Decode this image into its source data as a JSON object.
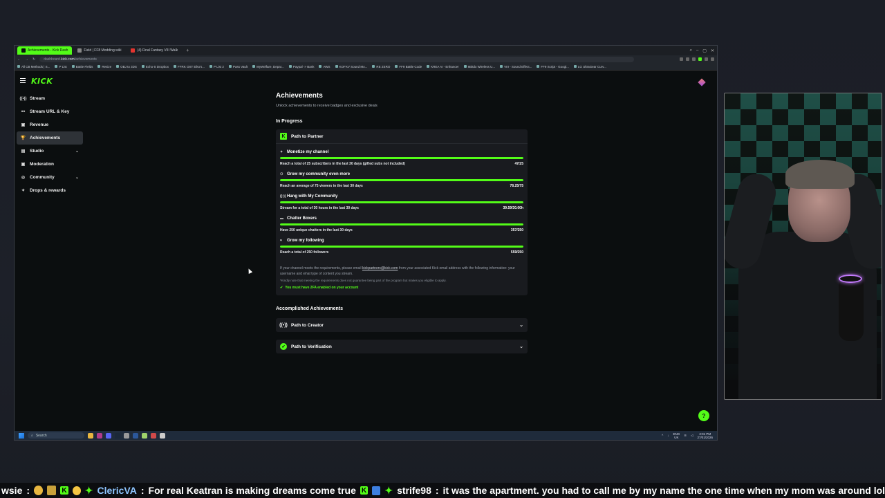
{
  "browser": {
    "tabs": [
      {
        "label": "Achievements - Kick Dash",
        "active": true
      },
      {
        "label": "Field | FF8 Modding wiki",
        "active": false
      },
      {
        "label": "(4) Final Fantasy VIII Walk",
        "active": false
      }
    ],
    "address_prefix": "dashboard.",
    "address_domain": "kick.com",
    "address_path": "/achievements",
    "bookmarks": [
      "All CB Methods | S...",
      "P List",
      "Battle Fields",
      "Resize",
      "OBJ to 3DS",
      "Echo-S Dropbox",
      "FFRK OST Eiko's...",
      "P List 2",
      "Pass Vault",
      "MyWelfare, Depar...",
      "Paypal -> Bank",
      "AWS",
      "KOFXV Sound Mo...",
      "RE ZERO",
      "FF9 Battle Code",
      "KREA AI - Enhancer",
      "8Bitdo Wireless U...",
      "VIII - Sound Effect...",
      "FF9 Script - Googl...",
      "LG UltraGear Curv..."
    ]
  },
  "kick": {
    "logo": "KICK",
    "sidebar": [
      {
        "label": "Stream",
        "icon": "broadcast-icon",
        "glyph": "((•))",
        "chevron": false,
        "active": false
      },
      {
        "label": "Stream URL & Key",
        "icon": "link-icon",
        "glyph": "⚯",
        "chevron": false,
        "active": false
      },
      {
        "label": "Revenue",
        "icon": "wallet-icon",
        "glyph": "▣",
        "chevron": false,
        "active": false
      },
      {
        "label": "Achievements",
        "icon": "trophy-icon",
        "glyph": "🏆",
        "chevron": false,
        "active": true
      },
      {
        "label": "Studio",
        "icon": "studio-icon",
        "glyph": "▤",
        "chevron": true,
        "active": false
      },
      {
        "label": "Moderation",
        "icon": "shield-icon",
        "glyph": "▣",
        "chevron": false,
        "active": false
      },
      {
        "label": "Community",
        "icon": "community-icon",
        "glyph": "◎",
        "chevron": true,
        "active": false
      },
      {
        "label": "Drops & rewards",
        "icon": "gift-icon",
        "glyph": "✦",
        "chevron": false,
        "active": false
      }
    ],
    "page_title": "Achievements",
    "subtitle": "Unlock achievements to receive badges and exclusive deals",
    "in_progress_heading": "In Progress",
    "partner_card": {
      "title": "Path to Partner",
      "goals": [
        {
          "title": "Monetize my channel",
          "icon": "sparkle-icon",
          "glyph": "✦",
          "desc": "Reach a total of 25 subscribers in the last 30 days (gifted subs not included)",
          "progress": "47/25",
          "fill": 1.0
        },
        {
          "title": "Grow my community even more",
          "icon": "users-icon",
          "glyph": "⚇",
          "desc": "Reach an average of 75 viewers in the last 30 days",
          "progress": "78.25/75",
          "fill": 1.0
        },
        {
          "title": "Hang with My Community",
          "icon": "broadcast-icon",
          "glyph": "((•))",
          "desc": "Stream for a total of 30 hours in the last 30 days",
          "progress": "39.59/30.00h",
          "fill": 1.0
        },
        {
          "title": "Chatter Boxers",
          "icon": "chat-icon",
          "glyph": "▬",
          "desc": "Have 250 unique chatters in the last 30 days",
          "progress": "357/250",
          "fill": 1.0
        },
        {
          "title": "Grow my following",
          "icon": "heart-icon",
          "glyph": "♥",
          "desc": "Reach a total of 250 followers",
          "progress": "559/250",
          "fill": 1.0
        }
      ],
      "info_before": "If your channel meets the requirements, please email ",
      "info_email": "kickpartners@kick.com",
      "info_after": " from your associated Kick email address with the following information: your username and what type of content you stream.",
      "note": "*Kindly note that meeting the requirements does not guarantee being part of the program but makes you eligible to apply.",
      "requirement": "You must have 2FA enabled on your account"
    },
    "accomplished_heading": "Accomplished Achievements",
    "accomplished": [
      {
        "title": "Path to Creator",
        "icon": "broadcast-icon",
        "glyph": "((•))"
      },
      {
        "title": "Path to Verification",
        "icon": "verified-icon",
        "glyph": "✔"
      }
    ]
  },
  "taskbar": {
    "search": "Search",
    "lang_1": "ENG",
    "lang_2": "UK",
    "time": "2:01 PM",
    "date": "27/01/2026"
  },
  "ticker": {
    "items": [
      {
        "user": "wsie",
        "msg": ""
      },
      {
        "user": "ClericVA",
        "msg": "For real Keatran is making dreams come true"
      },
      {
        "user": "strife98",
        "msg": "it was the apartment. you had to call me by my name the one time when my mom was around lol"
      }
    ]
  }
}
